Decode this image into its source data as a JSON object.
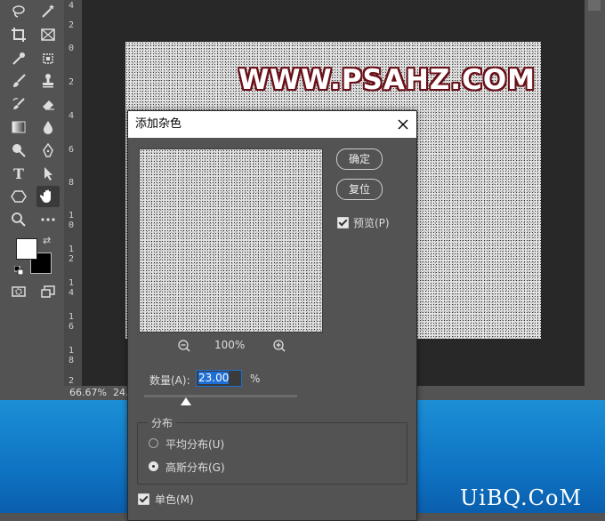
{
  "status": {
    "zoom": "66.67%",
    "info": "24."
  },
  "ruler_ticks": [
    "4",
    "2",
    "0",
    "2",
    "4",
    "6",
    "8",
    "1",
    "0",
    "1",
    "2",
    "1",
    "4",
    "1",
    "6",
    "1",
    "8",
    "2"
  ],
  "canvas": {
    "watermark": "WWW.PSAHZ.COM"
  },
  "dialog": {
    "title": "添加杂色",
    "ok_label": "确定",
    "reset_label": "复位",
    "preview_label": "预览(P)",
    "zoom_pct": "100%",
    "amount_label": "数量(A):",
    "amount_value": "23.00",
    "amount_unit": "%",
    "distribution_title": "分布",
    "uniform_label": "平均分布(U)",
    "gaussian_label": "高斯分布(G)",
    "monochrome_label": "单色(M)",
    "preview_checked": true,
    "monochrome_checked": true,
    "distribution_selected": "gaussian"
  },
  "footer_watermark": "UiBQ.CoM",
  "colors": {
    "panel": "#535353",
    "canvas_bg": "#282828",
    "accent": "#1e6fd6",
    "watermark_stroke": "#6a0f18",
    "desktop": "#0f74c4"
  },
  "tools": [
    "lasso-icon",
    "magic-wand-icon",
    "crop-icon",
    "frame-icon",
    "eyedropper-icon",
    "healing-icon",
    "brush-icon",
    "stamp-icon",
    "history-brush-icon",
    "eraser-icon",
    "gradient-icon",
    "blur-icon",
    "dodge-icon",
    "pen-icon",
    "type-icon",
    "path-select-icon",
    "shape-icon",
    "hand-icon",
    "zoom-icon",
    "more-icon"
  ]
}
